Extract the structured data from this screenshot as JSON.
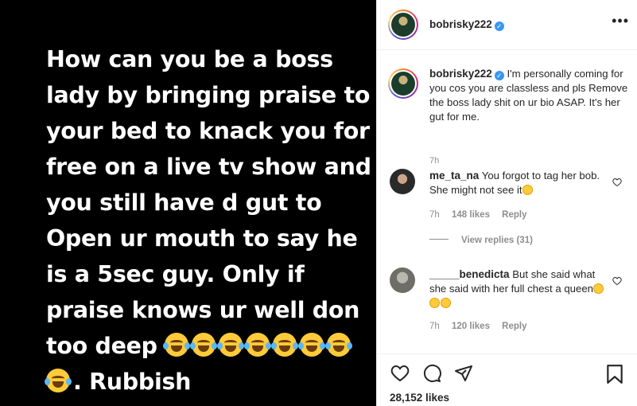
{
  "post_image": {
    "text": "How can you be a boss lady by bringing praise to your bed to knack you for free on a live tv show and you still have d gut to Open ur mouth to say he is a 5sec guy. Only if praise knows ur well don too deep",
    "ending": ". Rubbish"
  },
  "header": {
    "username": "bobrisky222",
    "more_label": "•••"
  },
  "caption": {
    "username": "bobrisky222",
    "text": "I'm personally coming for you cos you are classless and pls Remove the boss lady shit on ur bio ASAP. It's her gut for me.",
    "time": "7h"
  },
  "comments": [
    {
      "username": "me_ta_na",
      "text": "You forgot to tag her bob. She might not see it",
      "time": "7h",
      "likes": "148 likes",
      "reply": "Reply",
      "view_replies": "View replies (31)"
    },
    {
      "username": "_____benedicta",
      "text": "But she said what she said with her full chest a queen",
      "time": "7h",
      "likes": "120 likes",
      "reply": "Reply"
    }
  ],
  "footer": {
    "likes": "28,152 likes"
  },
  "icons": [
    "heart-icon",
    "comment-icon",
    "share-icon",
    "bookmark-icon",
    "verified-icon",
    "more-icon",
    "laughing-emoji-icon"
  ],
  "colors": {
    "verified": "#3897f0",
    "text": "#262626",
    "muted": "#8e8e8e",
    "emoji": "#ffcb3a"
  }
}
